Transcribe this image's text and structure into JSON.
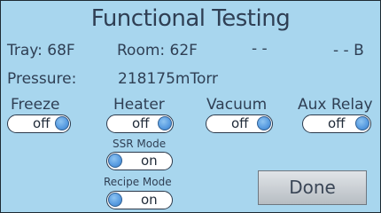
{
  "title": "Functional Testing",
  "readouts": {
    "tray": "Tray: 68F",
    "room": "Room: 62F",
    "extra1": "- -",
    "extra2": "- - B",
    "pressure_label": "Pressure:",
    "pressure_value": "218175mTorr"
  },
  "controls": {
    "freeze": {
      "label": "Freeze",
      "state": "off"
    },
    "heater": {
      "label": "Heater",
      "state": "off"
    },
    "vacuum": {
      "label": "Vacuum",
      "state": "off"
    },
    "aux_relay": {
      "label": "Aux Relay",
      "state": "off"
    },
    "ssr_mode": {
      "label": "SSR Mode",
      "state": "on"
    },
    "recipe_mode": {
      "label": "Recipe Mode",
      "state": "on"
    }
  },
  "done_label": "Done",
  "colors": {
    "background": "#a8d6ee",
    "text": "#2f3f54",
    "knob": "#5b9ee2",
    "button": "#c8cdd2"
  }
}
